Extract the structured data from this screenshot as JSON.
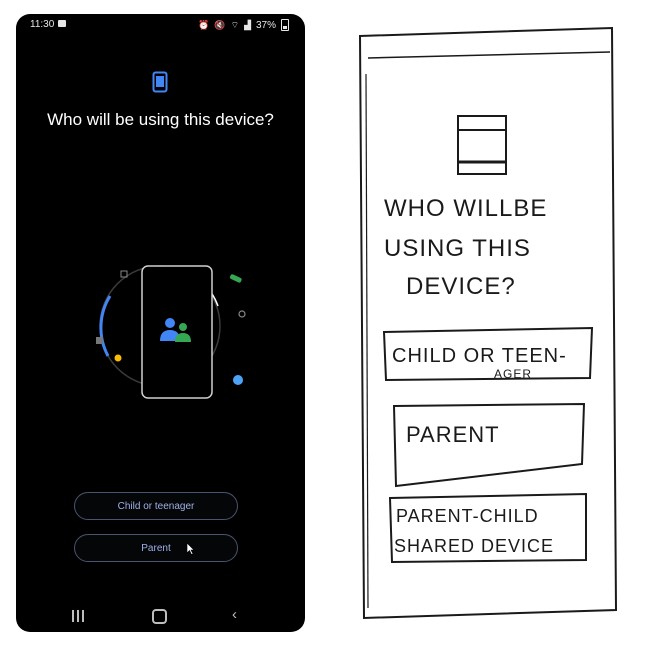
{
  "status_bar": {
    "time": "11:30",
    "battery": "37%",
    "icons": [
      "image-icon",
      "alarm-icon",
      "mute-icon",
      "wifi-icon",
      "signal-icon",
      "battery-icon"
    ]
  },
  "screen": {
    "title": "Who will be using this device?",
    "illustration_icon": "family-icon",
    "buttons": [
      {
        "label": "Child or teenager"
      },
      {
        "label": "Parent"
      }
    ]
  },
  "nav_bar": {
    "icons": [
      "recents-icon",
      "home-icon",
      "back-icon"
    ]
  },
  "sketch": {
    "title_lines": [
      "WHO WILLBE",
      "USING THIS",
      "DEVICE?"
    ],
    "option1_line1": "CHILD OR TEEN-",
    "option1_line2": "AGER",
    "option2": "PARENT",
    "option3_line1": "PARENT-CHILD",
    "option3_line2": "SHARED DEVICE"
  },
  "colors": {
    "phone_bg": "#000000",
    "title": "#ffffff",
    "button_text": "#9fb0e8",
    "button_border": "#4a5470",
    "accent_blue": "#4285f4",
    "accent_green": "#34a853",
    "accent_yellow": "#fbbc04",
    "accent_light_blue": "#4fa3f7"
  }
}
